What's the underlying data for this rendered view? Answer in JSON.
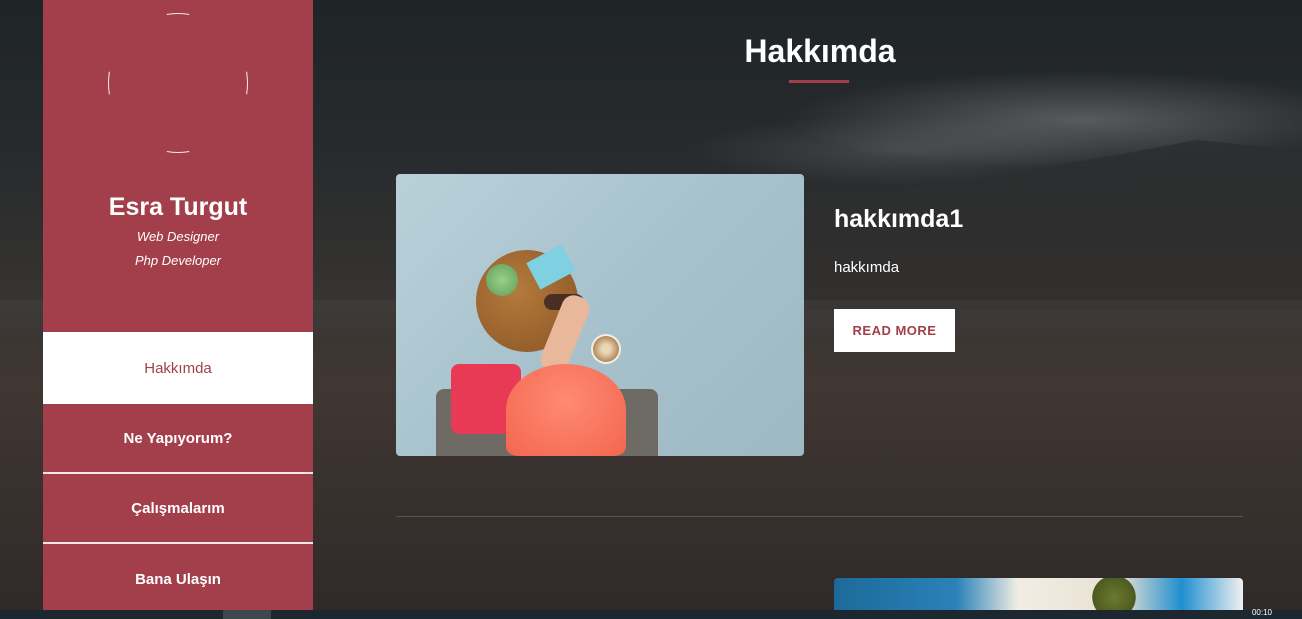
{
  "sidebar": {
    "name": "Esra Turgut",
    "roles": [
      "Web Designer",
      "Php Developer"
    ],
    "nav": [
      {
        "label": "Hakkımda",
        "active": true
      },
      {
        "label": "Ne Yapıyorum?",
        "active": false
      },
      {
        "label": "Çalışmalarım",
        "active": false
      },
      {
        "label": "Bana Ulaşın",
        "active": false
      }
    ]
  },
  "main": {
    "title": "Hakkımda",
    "post": {
      "title": "hakkımda1",
      "text": "hakkımda",
      "button": "READ MORE"
    }
  },
  "colors": {
    "accent": "#a23f4b",
    "background": "#2a2d30"
  },
  "taskbar": {
    "clock": "00:10"
  }
}
